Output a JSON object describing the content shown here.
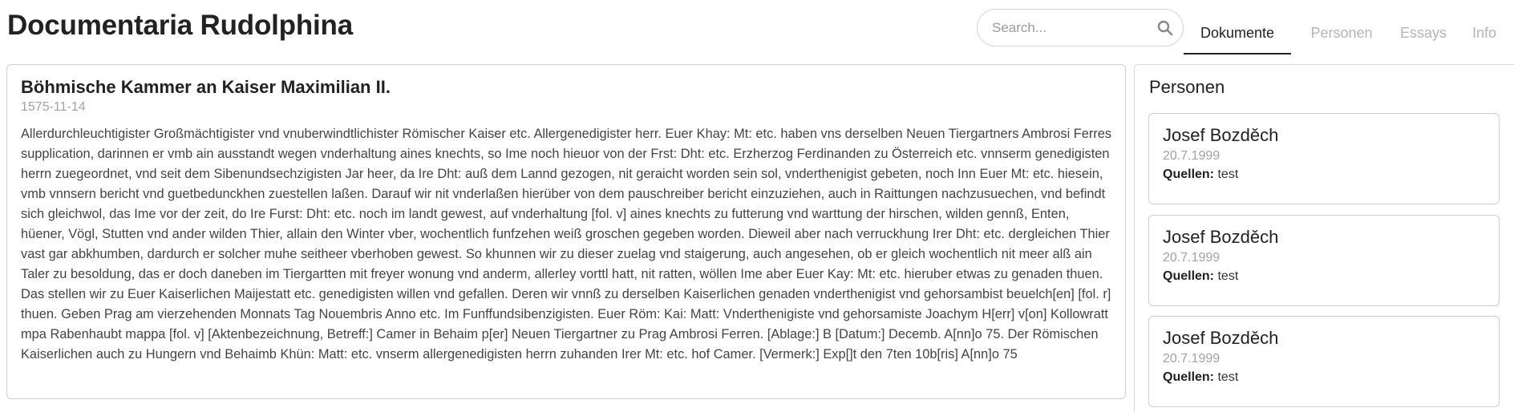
{
  "app": {
    "title": "Documentaria Rudolphina"
  },
  "search": {
    "placeholder": "Search...",
    "value": "",
    "icon": "search-icon"
  },
  "tabs": [
    {
      "label": "Dokumente",
      "active": true
    },
    {
      "label": "Personen",
      "active": false
    },
    {
      "label": "Essays",
      "active": false
    },
    {
      "label": "Info",
      "active": false
    }
  ],
  "document": {
    "title": "Böhmische Kammer an Kaiser Maximilian II.",
    "date": "1575-11-14",
    "body": "Allerdurchleuchtigister Großmächtigister vnd vnuberwindtlichister Römischer Kaiser etc. Allergenedigister herr. Euer Khay: Mt: etc. haben vns derselben Neuen Tiergartners Ambrosi Ferres supplication, darinnen er vmb ain ausstandt wegen vnderhaltung aines knechts, so Ime noch hieuor von der Frst: Dht: etc. Erzherzog Ferdinanden zu Österreich etc. vnnserm genedigisten herrn zuegeordnet, vnd seit dem Sibenundsechzigisten Jar heer, da Ire Dht: auß dem Lannd gezogen, nit geraicht worden sein sol, vnderthenigist gebeten, noch Inn Euer Mt: etc. hiesein, vmb vnnsern bericht vnd guetbedunckhen zuestellen laßen. Darauf wir nit vnderlaßen hierüber von dem pauschreiber bericht einzuziehen, auch in Raittungen nachzusuechen, vnd befindt sich gleichwol, das Ime vor der zeit, do Ire Furst: Dht: etc. noch im landt gewest, auf vnderhaltung [fol. v] aines knechts zu futterung vnd warttung der hirschen, wilden gennß, Enten, hüener, Vögl, Stutten vnd ander wilden Thier, allain den Winter vber, wochentlich funfzehen weiß groschen gegeben worden. Dieweil aber nach verruckhung Irer Dht: etc. dergleichen Thier vast gar abkhumben, dardurch er solcher muhe seitheer vberhoben gewest. So khunnen wir zu dieser zuelag vnd staigerung, auch angesehen, ob er gleich wochentlich nit meer alß ain Taler zu besoldung, das er doch daneben im Tiergartten mit freyer wonung vnd anderm, allerley vorttl hatt, nit ratten, wöllen Ime aber Euer Kay: Mt: etc. hieruber etwas zu genaden thuen. Das stellen wir zu Euer Kaiserlichen Maijestatt etc. genedigisten willen vnd gefallen. Deren wir vnnß zu derselben Kaiserlichen genaden vnderthenigist vnd gehorsambist beuelch[en] [fol. r] thuen. Geben Prag am vierzehenden Monnats Tag Nouembris Anno etc. Im Funffundsibenzigisten. Euer Röm: Kai: Matt: Vnderthenigiste vnd gehorsamiste Joachym H[err] v[on] Kollowratt mpa Rabenhaubt mappa [fol. v] [Aktenbezeichnung, Betreff:] Camer in Behaim p[er] Neuen Tiergartner zu Prag Ambrosi Ferren. [Ablage:] B [Datum:] Decemb. A[nn]o 75. Der Römischen Kaiserlichen auch zu Hungern vnd Behaimb Khün: Matt: etc. vnserm allergenedigisten herrn zuhanden Irer Mt: etc. hof Camer. [Vermerk:] Exp[]t den 7ten 10b[ris] A[nn]o 75"
  },
  "sidebar": {
    "heading": "Personen",
    "persons": [
      {
        "name": "Josef Bozděch",
        "date": "20.7.1999",
        "sources_label": "Quellen:",
        "sources_value": "test"
      },
      {
        "name": "Josef Bozděch",
        "date": "20.7.1999",
        "sources_label": "Quellen:",
        "sources_value": "test"
      },
      {
        "name": "Josef Bozděch",
        "date": "20.7.1999",
        "sources_label": "Quellen:",
        "sources_value": "test"
      }
    ]
  }
}
